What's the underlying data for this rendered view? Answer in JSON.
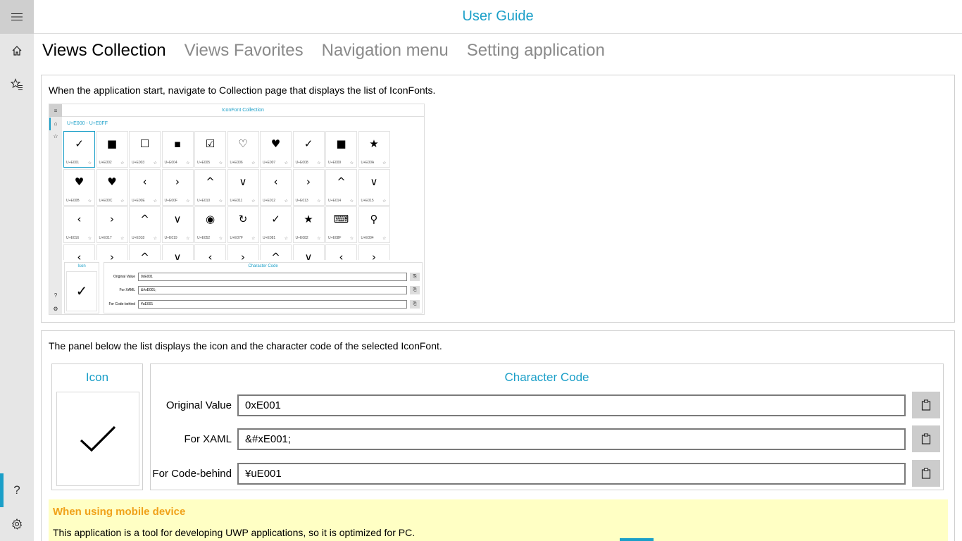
{
  "window": {
    "title": "User Guide"
  },
  "nav": {
    "menu_icon": "hamburger-icon",
    "items": [
      {
        "name": "home",
        "icon": "home-icon"
      },
      {
        "name": "favorites",
        "icon": "star-list-icon"
      }
    ],
    "footer": [
      {
        "name": "help",
        "icon": "question-icon",
        "glyph": "?"
      },
      {
        "name": "settings",
        "icon": "gear-icon"
      }
    ]
  },
  "tabs": [
    {
      "label": "Views Collection",
      "active": true
    },
    {
      "label": "Views Favorites",
      "active": false
    },
    {
      "label": "Navigation menu",
      "active": false
    },
    {
      "label": "Setting application",
      "active": false
    }
  ],
  "section1": {
    "text": "When the application start, navigate to Collection page that displays the list of IconFonts.",
    "screenshot": {
      "title": "IconFont Collection",
      "range": "U+E000 - U+E0FF",
      "cells": [
        {
          "glyph": "✓",
          "code": "U+E001"
        },
        {
          "glyph": "■",
          "code": "U+E002"
        },
        {
          "glyph": "☐",
          "code": "U+E003"
        },
        {
          "glyph": "▪",
          "code": "U+E004"
        },
        {
          "glyph": "☑",
          "code": "U+E005"
        },
        {
          "glyph": "♡",
          "code": "U+E006"
        },
        {
          "glyph": "♥",
          "code": "U+E007"
        },
        {
          "glyph": "✓",
          "code": "U+E008"
        },
        {
          "glyph": "■",
          "code": "U+E009"
        },
        {
          "glyph": "★",
          "code": "U+E00A"
        },
        {
          "glyph": "♥",
          "code": "U+E00B"
        },
        {
          "glyph": "♥",
          "code": "U+E00C"
        },
        {
          "glyph": "‹",
          "code": "U+E00E"
        },
        {
          "glyph": "›",
          "code": "U+E00F"
        },
        {
          "glyph": "^",
          "code": "U+E010"
        },
        {
          "glyph": "∨",
          "code": "U+E011"
        },
        {
          "glyph": "‹",
          "code": "U+E012"
        },
        {
          "glyph": "›",
          "code": "U+E013"
        },
        {
          "glyph": "^",
          "code": "U+E014"
        },
        {
          "glyph": "∨",
          "code": "U+E015"
        },
        {
          "glyph": "‹",
          "code": "U+E016"
        },
        {
          "glyph": "›",
          "code": "U+E017"
        },
        {
          "glyph": "^",
          "code": "U+E018"
        },
        {
          "glyph": "∨",
          "code": "U+E019"
        },
        {
          "glyph": "◉",
          "code": "U+E052"
        },
        {
          "glyph": "↻",
          "code": "U+E07F"
        },
        {
          "glyph": "✓",
          "code": "U+E081"
        },
        {
          "glyph": "★",
          "code": "U+E082"
        },
        {
          "glyph": "⌨",
          "code": "U+E08F"
        },
        {
          "glyph": "⚲",
          "code": "U+E094"
        },
        {
          "glyph": "‹",
          "code": ""
        },
        {
          "glyph": "›",
          "code": ""
        },
        {
          "glyph": "^",
          "code": ""
        },
        {
          "glyph": "∨",
          "code": ""
        },
        {
          "glyph": "‹",
          "code": ""
        },
        {
          "glyph": "›",
          "code": ""
        },
        {
          "glyph": "^",
          "code": ""
        },
        {
          "glyph": "∨",
          "code": ""
        },
        {
          "glyph": "‹",
          "code": ""
        },
        {
          "glyph": "›",
          "code": ""
        }
      ],
      "panel": {
        "icon_title": "Icon",
        "code_title": "Character Code",
        "rows": [
          {
            "label": "Original Value",
            "value": "0xE001"
          },
          {
            "label": "For XAML",
            "value": "&#xE001;"
          },
          {
            "label": "For Code-behind",
            "value": "¥uE001"
          }
        ]
      }
    }
  },
  "section2": {
    "text": "The panel below the list displays the icon and the character code of the selected IconFont.",
    "icon_title": "Icon",
    "code_title": "Character Code",
    "rows": [
      {
        "label": "Original Value",
        "value": "0xE001",
        "copy_icon": "clipboard-icon"
      },
      {
        "label": "For XAML",
        "value": "&#xE001;",
        "copy_icon": "clipboard-icon"
      },
      {
        "label": "For Code-behind",
        "value": "¥uE001",
        "copy_icon": "clipboard-icon"
      }
    ]
  },
  "note": {
    "title": "When using mobile device",
    "text": "This application is a tool for developing UWP applications, so it is optimized for PC."
  },
  "colors": {
    "accent": "#1b9fc8",
    "note_bg": "#ffffc4",
    "note_title": "#f0a21a"
  }
}
